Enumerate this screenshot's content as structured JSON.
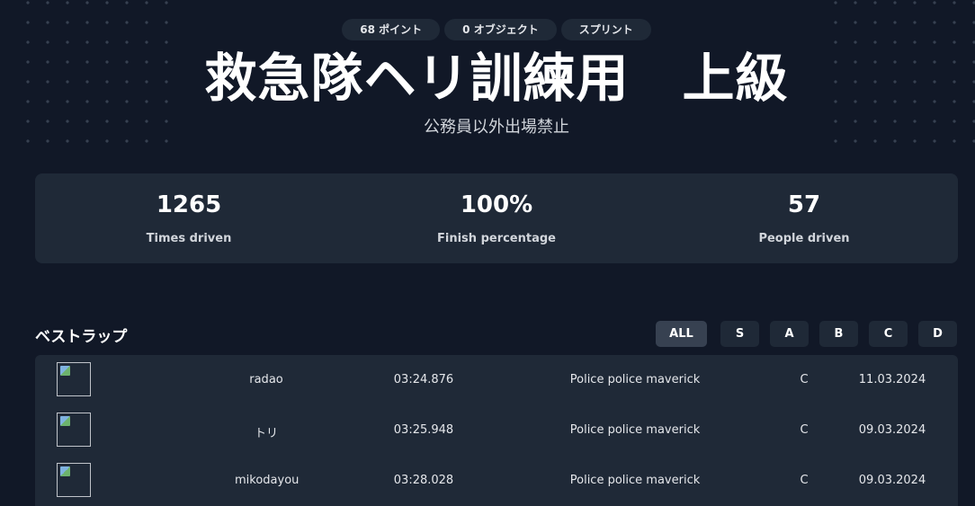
{
  "header": {
    "tags": [
      "68 ポイント",
      "0 オブジェクト",
      "スプリント"
    ],
    "title": "救急隊ヘリ訓練用　上級",
    "subtitle": "公務員以外出場禁止"
  },
  "stats": [
    {
      "value": "1265",
      "label": "Times driven"
    },
    {
      "value": "100%",
      "label": "Finish percentage"
    },
    {
      "value": "57",
      "label": "People driven"
    }
  ],
  "laps": {
    "title": "ベストラップ",
    "filters": [
      "ALL",
      "S",
      "A",
      "B",
      "C",
      "D"
    ],
    "active_filter": "ALL",
    "rows": [
      {
        "name": "radao",
        "time": "03:24.876",
        "vehicle": "Police police maverick",
        "class": "C",
        "date": "11.03.2024"
      },
      {
        "name": "トリ",
        "time": "03:25.948",
        "vehicle": "Police police maverick",
        "class": "C",
        "date": "09.03.2024"
      },
      {
        "name": "mikodayou",
        "time": "03:28.028",
        "vehicle": "Police police maverick",
        "class": "C",
        "date": "09.03.2024"
      }
    ]
  },
  "colors": {
    "background": "#111827",
    "card": "#1f2937",
    "active_filter": "#374151"
  },
  "icons": {
    "avatar": "broken-image-icon"
  }
}
